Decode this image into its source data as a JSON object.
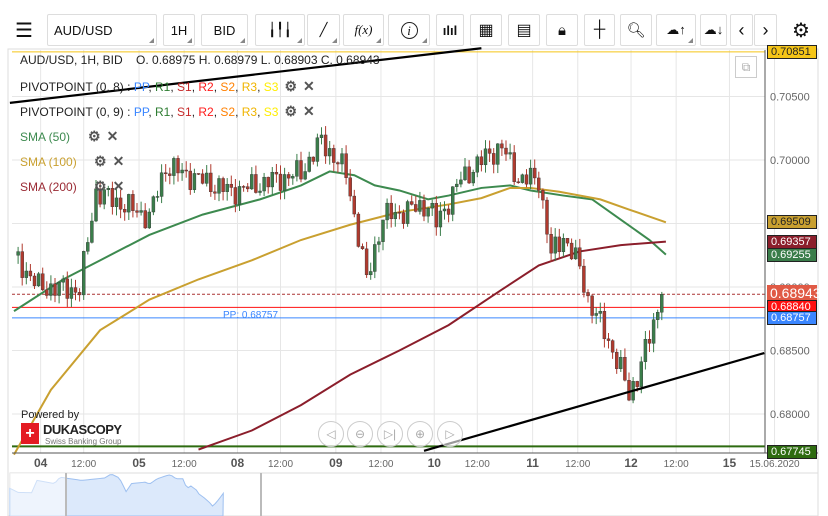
{
  "toolbar": {
    "symbol": "AUD/USD",
    "timeframe": "1H",
    "side": "BID",
    "icons": [
      "menu-icon",
      "candle-type-icon",
      "draw-pen-icon",
      "function-icon",
      "info-icon",
      "volume-bars-icon",
      "calendar-icon",
      "report-icon",
      "lock-icon",
      "crosshair-icon",
      "zoom-search-icon",
      "cloud-upload-icon",
      "cloud-download-icon",
      "chevron-left-icon",
      "chevron-right-icon",
      "gear-icon"
    ],
    "fx_label": "f(x)"
  },
  "legend": {
    "title": "AUD/USD, 1H, BID",
    "ohlc": "O. 0.68975 H. 0.68979 L. 0.68903 C. 0.68943",
    "pivots": [
      {
        "name": "PIVOTPOINT (0, 8)"
      },
      {
        "name": "PIVOTPOINT (0, 9)"
      }
    ],
    "pivot_sep": ":",
    "pivot_levels": [
      {
        "t": "PP",
        "c": "#3a86ff"
      },
      {
        "t": "R1",
        "c": "#2e7d32"
      },
      {
        "t": "S1",
        "c": "#c62828"
      },
      {
        "t": "R2",
        "c": "#ff1a1a"
      },
      {
        "t": "S2",
        "c": "#ff8000"
      },
      {
        "t": "R3",
        "c": "#f0b400"
      },
      {
        "t": "S3",
        "c": "#ffee00"
      }
    ],
    "smas": [
      {
        "name": "SMA (50)",
        "color": "#3d8a4f"
      },
      {
        "name": "SMA (100)",
        "color": "#c9a030"
      },
      {
        "name": "SMA (200)",
        "color": "#9a2a34"
      }
    ]
  },
  "pp_label": "PP: 0.68757",
  "brand": {
    "powered": "Powered by",
    "name": "DUKASCOPY",
    "tagline": "Swiss Banking Group"
  },
  "price_labels": [
    {
      "v": "0.70851",
      "bg": "#f5c518",
      "fg": "#222"
    },
    {
      "v": "0.69509",
      "bg": "#c9a030",
      "fg": "#222"
    },
    {
      "v": "0.69357",
      "bg": "#8b1e2b",
      "fg": "#fff"
    },
    {
      "v": "0.69255",
      "bg": "#3a7d4a",
      "fg": "#fff"
    },
    {
      "v": "0.68943",
      "bg": "#e05a45",
      "fg": "#fff"
    },
    {
      "v": "0.68840",
      "bg": "#ff1010",
      "fg": "#fff"
    },
    {
      "v": "0.68757",
      "bg": "#3a86ff",
      "fg": "#fff"
    },
    {
      "v": "0.67745",
      "bg": "#2e6b10",
      "fg": "#fff"
    }
  ],
  "chart_data": {
    "type": "candlestick",
    "title": "AUD/USD, 1H, BID",
    "ylim": [
      0.6773,
      0.7088
    ],
    "y_ticks": [
      "0.70500",
      "0.70000",
      "0.69500",
      "0.69000",
      "0.68500",
      "0.68000"
    ],
    "y_tick_values": [
      0.705,
      0.7,
      0.695,
      0.69,
      0.685,
      0.68
    ],
    "x_ticks": [
      {
        "h": 6.5,
        "t": "04",
        "bold": true
      },
      {
        "h": 17,
        "t": "12:00"
      },
      {
        "h": 30.5,
        "t": "05",
        "bold": true
      },
      {
        "h": 41.5,
        "t": "12:00"
      },
      {
        "h": 54.5,
        "t": "08",
        "bold": true
      },
      {
        "h": 65,
        "t": "12:00"
      },
      {
        "h": 78.5,
        "t": "09",
        "bold": true
      },
      {
        "h": 89.5,
        "t": "12:00"
      },
      {
        "h": 102.5,
        "t": "10",
        "bold": true
      },
      {
        "h": 113,
        "t": "12:00"
      },
      {
        "h": 126.5,
        "t": "11",
        "bold": true
      },
      {
        "h": 137.5,
        "t": "12:00"
      },
      {
        "h": 150.5,
        "t": "12",
        "bold": true
      },
      {
        "h": 161.5,
        "t": "12:00"
      },
      {
        "h": 174.5,
        "t": "15",
        "bold": true
      },
      {
        "h": 185.5,
        "t": "15.06.2020"
      }
    ],
    "close_keypoints": [
      [
        0,
        0.6925
      ],
      [
        6,
        0.69
      ],
      [
        16,
        0.6898
      ],
      [
        20,
        0.6975
      ],
      [
        33,
        0.6955
      ],
      [
        37,
        0.6995
      ],
      [
        53,
        0.6975
      ],
      [
        70,
        0.699
      ],
      [
        75,
        0.7015
      ],
      [
        81,
        0.699
      ],
      [
        84,
        0.694
      ],
      [
        86,
        0.6905
      ],
      [
        90,
        0.6955
      ],
      [
        101,
        0.6965
      ],
      [
        103,
        0.695
      ],
      [
        109,
        0.6985
      ],
      [
        116,
        0.7005
      ],
      [
        119,
        0.701
      ],
      [
        123,
        0.6985
      ],
      [
        128,
        0.6985
      ],
      [
        131,
        0.6925
      ],
      [
        134,
        0.694
      ],
      [
        138,
        0.6915
      ],
      [
        140,
        0.689
      ],
      [
        144,
        0.6865
      ],
      [
        148,
        0.6835
      ],
      [
        150,
        0.6815
      ],
      [
        152,
        0.683
      ],
      [
        155,
        0.686
      ],
      [
        158,
        0.68943
      ]
    ],
    "series": [
      {
        "name": "SMA (50)",
        "color": "#3d8a4f",
        "points": [
          [
            0,
            0.6881
          ],
          [
            12,
            0.6906
          ],
          [
            21,
            0.6921
          ],
          [
            33,
            0.6941
          ],
          [
            46,
            0.6957
          ],
          [
            60,
            0.6969
          ],
          [
            70,
            0.698
          ],
          [
            77,
            0.6991
          ],
          [
            83,
            0.6988
          ],
          [
            88,
            0.698
          ],
          [
            94,
            0.6976
          ],
          [
            101,
            0.6969
          ],
          [
            106,
            0.6972
          ],
          [
            114,
            0.6978
          ],
          [
            121,
            0.698
          ],
          [
            126,
            0.6976
          ],
          [
            134,
            0.6972
          ],
          [
            141,
            0.6969
          ],
          [
            148,
            0.6953
          ],
          [
            155,
            0.6937
          ],
          [
            159,
            0.69255
          ]
        ]
      },
      {
        "name": "SMA (100)",
        "color": "#c9a030",
        "points": [
          [
            0,
            0.6768
          ],
          [
            9,
            0.6819
          ],
          [
            21,
            0.6866
          ],
          [
            33,
            0.689
          ],
          [
            45,
            0.6906
          ],
          [
            58,
            0.6921
          ],
          [
            70,
            0.6937
          ],
          [
            82,
            0.6949
          ],
          [
            94,
            0.6959
          ],
          [
            106,
            0.6965
          ],
          [
            114,
            0.697
          ],
          [
            121,
            0.6978
          ],
          [
            126,
            0.6978
          ],
          [
            133,
            0.6975
          ],
          [
            143,
            0.6969
          ],
          [
            150,
            0.6961
          ],
          [
            159,
            0.69509
          ]
        ]
      },
      {
        "name": "SMA (200)",
        "color": "#8b1e2b",
        "points": [
          [
            45,
            0.6772
          ],
          [
            58,
            0.6787
          ],
          [
            70,
            0.6807
          ],
          [
            82,
            0.6831
          ],
          [
            94,
            0.685
          ],
          [
            106,
            0.687
          ],
          [
            119,
            0.6898
          ],
          [
            128,
            0.6917
          ],
          [
            138,
            0.6928
          ],
          [
            148,
            0.6933
          ],
          [
            159,
            0.69357
          ]
        ]
      }
    ],
    "hlines": [
      {
        "v": 0.70851,
        "color": "#f5c518"
      },
      {
        "v": 0.6884,
        "color": "#ff1010"
      },
      {
        "v": 0.68757,
        "color": "#3a86ff"
      },
      {
        "v": 0.67745,
        "color": "#2e6b10"
      },
      {
        "v": 0.68943,
        "color": "#a33",
        "dashed": true
      }
    ],
    "trendlines": [
      {
        "from": [
          -1,
          0.7045
        ],
        "to": [
          114,
          0.7088
        ]
      },
      {
        "from": [
          100,
          0.6771
        ],
        "to": [
          183,
          0.6848
        ]
      }
    ]
  }
}
